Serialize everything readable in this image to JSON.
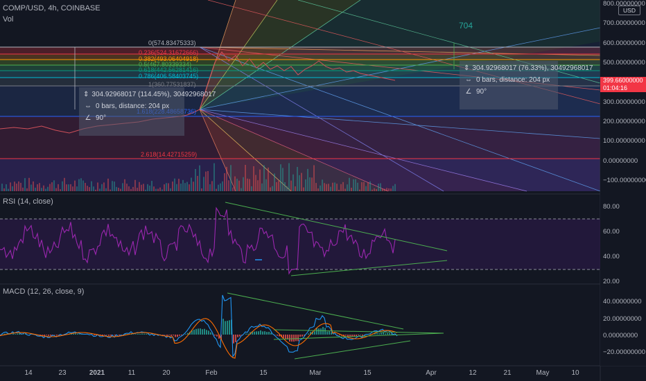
{
  "header": {
    "symbol": "COMP/USD, 4h, COINBASE",
    "volume_label": "Vol",
    "currency_badge": "USD"
  },
  "price_axis": {
    "labels": [
      "800.00000000",
      "700.00000000",
      "600.00000000",
      "500.00000000",
      "400.00000000",
      "300.00000000",
      "200.00000000",
      "100.00000000",
      "0.00000000",
      "−100.00000000"
    ],
    "current_price": "399.66000000",
    "countdown": "01:04:16"
  },
  "time_axis": {
    "labels": [
      "14",
      "23",
      "2021",
      "11",
      "20",
      "Feb",
      "15",
      "Mar",
      "15",
      "Apr",
      "12",
      "21",
      "May",
      "10"
    ]
  },
  "fib_levels": [
    {
      "label": "0(574.83475333)",
      "color": "#b2b5be"
    },
    {
      "label": "0.236(524.31672666)",
      "color": "#f23645"
    },
    {
      "label": "0.382(493.06404918)",
      "color": "#ff9800"
    },
    {
      "label": "0.5(467.80339334)",
      "color": "#4caf50"
    },
    {
      "label": "0.618(442.56281416)",
      "color": "#089981"
    },
    {
      "label": "0.786(406.58403745)",
      "color": "#00bcd4"
    },
    {
      "label": "1(360.77531837)",
      "color": "#787b86"
    },
    {
      "label": "1.618(228.48658736)",
      "color": "#2962ff"
    },
    {
      "label": "2.618(14.42715259)",
      "color": "#f23645"
    }
  ],
  "measure_boxes": [
    {
      "line1": "304.92968017 (114.45%), 30492968017",
      "line2": "0 bars, distance: 204 px",
      "line3": "90°"
    },
    {
      "line1": "304.92968017 (76.33%), 30492968017",
      "line2": "0 bars, distance: 204 px",
      "line3": "90°"
    }
  ],
  "annotation_704": "704",
  "rsi": {
    "title": "RSI (14, close)",
    "labels": [
      "80.00",
      "60.00",
      "40.00",
      "20.00"
    ]
  },
  "macd": {
    "title": "MACD (12, 26, close, 9)",
    "labels": [
      "40.00000000",
      "20.00000000",
      "0.00000000",
      "−20.00000000"
    ]
  },
  "colors": {
    "background": "#131722",
    "rsi_line": "#9c27b0",
    "macd_line": "#2196f3",
    "signal_line": "#ff6d00",
    "trend_line": "#4caf50",
    "price_badge": "#f23645"
  }
}
